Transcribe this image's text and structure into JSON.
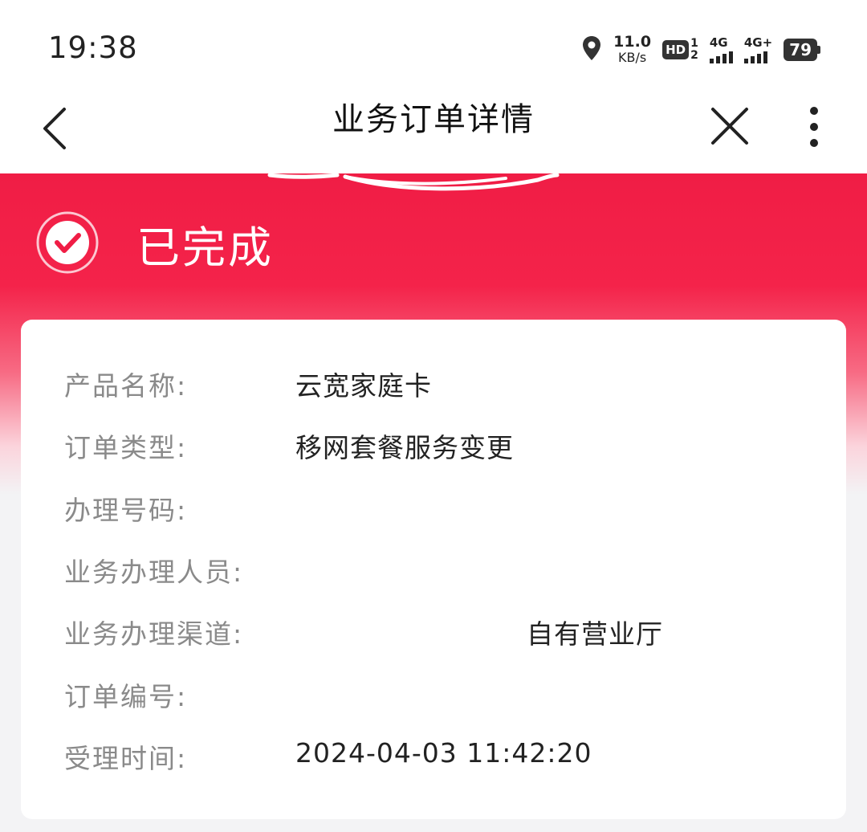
{
  "status_bar": {
    "time": "19:38",
    "net_speed_value": "11.0",
    "net_speed_unit": "KB/s",
    "hd_label": "HD",
    "hd_sub_top": "1",
    "hd_sub_bottom": "2",
    "signal1_label": "4G",
    "signal2_label": "4G+",
    "battery": "79"
  },
  "nav": {
    "title": "业务订单详情"
  },
  "order_status": {
    "text": "已完成",
    "color": "#f01d45"
  },
  "details": [
    {
      "label": "产品名称:",
      "value": "云宽家庭卡"
    },
    {
      "label": "订单类型:",
      "value": "移网套餐服务变更"
    },
    {
      "label": "办理号码:",
      "value": ""
    },
    {
      "label": "业务办理人员:",
      "value": ""
    },
    {
      "label": "业务办理渠道:",
      "value": "自有营业厅"
    },
    {
      "label": "订单编号:",
      "value": ""
    },
    {
      "label": "受理时间:",
      "value": "2024-04-03 11:42:20"
    }
  ]
}
